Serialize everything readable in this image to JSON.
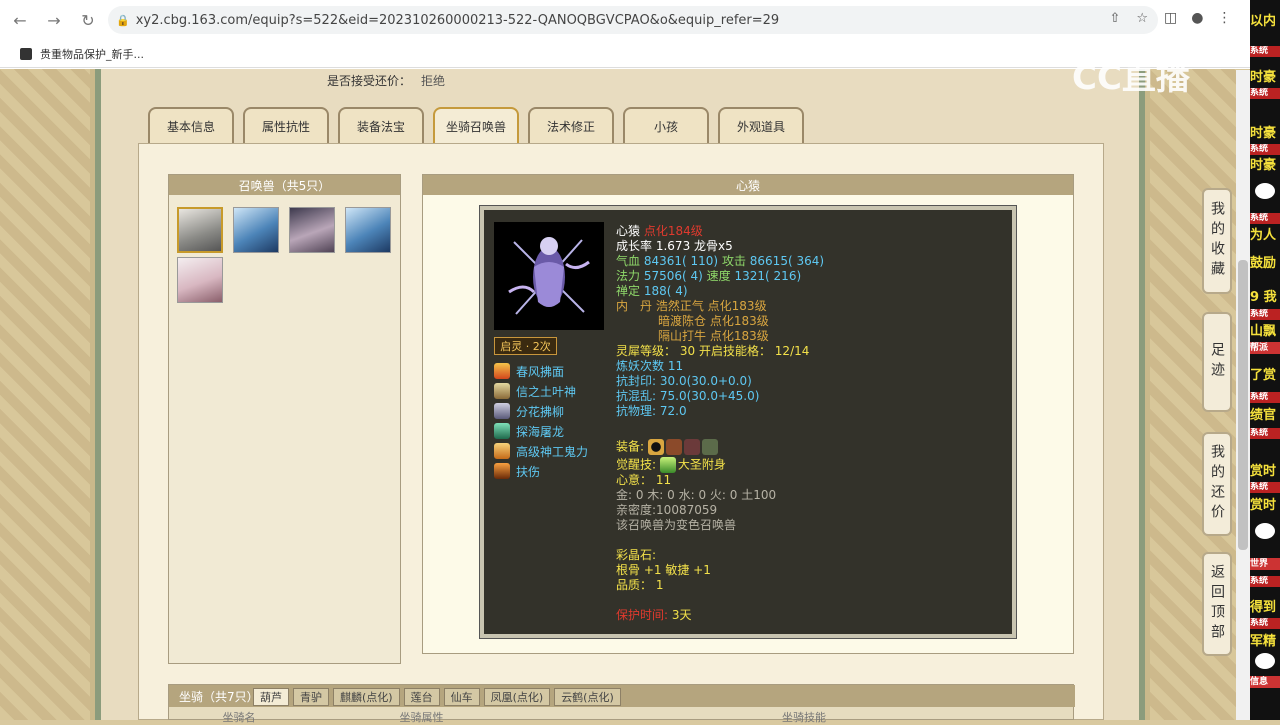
{
  "browser": {
    "url": "xy2.cbg.163.com/equip?s=522&eid=202310260000213-522-QANOQBGVCPAO&o&equip_refer=29",
    "bookmark": "贵重物品保护_新手..."
  },
  "watermark": "CC直播",
  "page": {
    "bargain_label": "是否接受还价：",
    "bargain_value": "拒绝",
    "tabs": [
      "基本信息",
      "属性抗性",
      "装备法宝",
      "坐骑召唤兽",
      "法术修正",
      "小孩",
      "外观道具"
    ],
    "active_tab": 3
  },
  "pets": {
    "header": "召唤兽（共5只）"
  },
  "detail": {
    "header": "心猿",
    "qiling": "启灵 · 2次",
    "skills": [
      "春风拂面",
      "信之土叶神",
      "分花拂柳",
      "探海屠龙",
      "高级神工鬼力",
      "扶伤"
    ],
    "stats": {
      "name": "心猿",
      "level": "点化184级",
      "growth_label": "成长率",
      "growth": "1.673",
      "bones": "龙骨x5",
      "hp_label": "气血",
      "hp": "84361( 110)",
      "atk_label": "攻击",
      "atk": "86615( 364)",
      "mp_label": "法力",
      "mp": "57506( 4)",
      "spd_label": "速度",
      "spd": "1321( 216)",
      "zen_label": "禅定",
      "zen": "188( 4)",
      "neidan_label": "内　丹",
      "neidan": [
        "浩然正气 点化183级",
        "暗渡陈仓 点化183级",
        "隔山打牛 点化183级"
      ],
      "lingxi_label": "灵犀等级：",
      "lingxi": "30",
      "skillslot_label": "开启技能格：",
      "skillslot": "12/14",
      "lianyao_label": "炼妖次数",
      "lianyao": "11",
      "kangfeng": "抗封印: 30.0(30.0+0.0)",
      "kanghun": "抗混乱: 75.0(30.0+45.0)",
      "kangwuli": "抗物理: 72.0",
      "equip_label": "装备:",
      "awaken_label": "觉醒技:",
      "awaken": "大圣附身",
      "xinyi": "心意： 11",
      "wuxing": "金: 0 木: 0 水: 0 火: 0 土100",
      "qinmi": "亲密度:10087059",
      "bianse": "该召唤兽为变色召唤兽",
      "caijing_label": "彩晶石:",
      "caijing": "根骨 +1 敏捷 +1",
      "pinzhi": "品质： 1",
      "protect_label": "保护时间:",
      "protect": "3天"
    }
  },
  "mounts": {
    "title": "坐骑（共7只）",
    "tabs": [
      "葫芦",
      "青驴",
      "麒麟(点化)",
      "莲台",
      "仙车",
      "凤凰(点化)",
      "云鹤(点化)"
    ],
    "columns": [
      "坐骑名",
      "坐骑属性",
      "坐骑技能"
    ]
  },
  "side_buttons": [
    "我的收藏",
    "足迹",
    "我的还价",
    "返回顶部"
  ],
  "danmu": [
    "以内",
    "系统",
    "时豪",
    "系统",
    "时豪",
    "系统",
    "时豪",
    "系统",
    "为人",
    "鼓励",
    "9 我",
    "系统",
    "山飘",
    "帮派",
    "了赏",
    "系统",
    "绩官",
    "系统",
    "赏时",
    "系统",
    "赏时",
    "系统",
    "世界",
    "系统",
    "得到",
    "系统",
    "军精",
    "信息"
  ]
}
